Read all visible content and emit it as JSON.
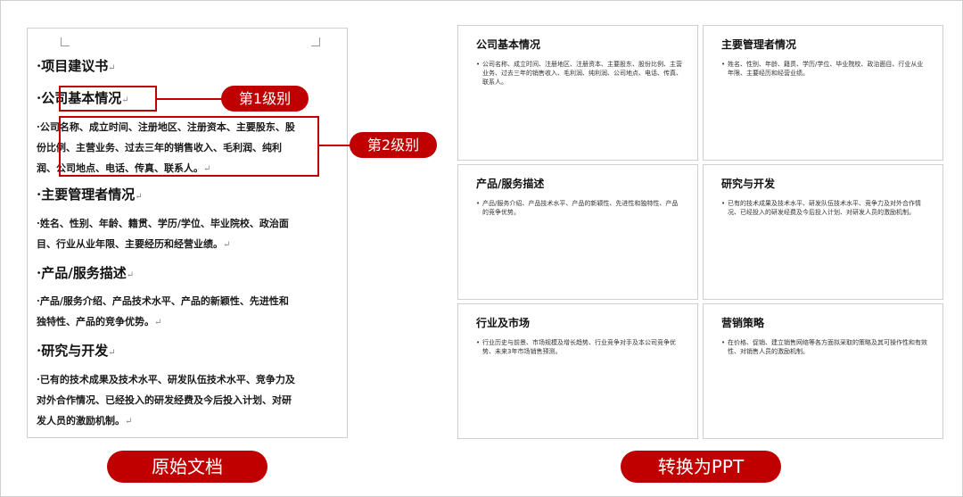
{
  "doc": {
    "title": "·项目建议书",
    "sections": [
      {
        "heading": "·公司基本情况",
        "body": "·公司名称、成立时间、注册地区、注册资本、主要股东、股份比例、主营业务、过去三年的销售收入、毛利润、纯利润、公司地点、电话、传真、联系人。"
      },
      {
        "heading": "·主要管理者情况",
        "body": "·姓名、性别、年龄、籍贯、学历/学位、毕业院校、政治面目、行业从业年限、主要经历和经营业绩。"
      },
      {
        "heading": "·产品/服务描述",
        "body": "·产品/服务介绍、产品技术水平、产品的新颖性、先进性和独特性、产品的竞争优势。"
      },
      {
        "heading": "·研究与开发",
        "body": "·已有的技术成果及技术水平、研发队伍技术水平、竞争力及对外合作情况、已经投入的研发经费及今后投入计划、对研发人员的激励机制。"
      }
    ],
    "mark": "↵"
  },
  "callouts": {
    "level1": "第1级别",
    "level2": "第2级别"
  },
  "captions": {
    "original": "原始文档",
    "converted": "转换为PPT"
  },
  "slides": [
    {
      "title": "公司基本情况",
      "bullet": "公司名称、成立时间、注册地区、注册资本、主要股东、股份比例、主营业务、过去三年的销售收入、毛利润、纯利润、公司地点、电话、传真、联系人。"
    },
    {
      "title": "主要管理者情况",
      "bullet": "姓名、性别、年龄、籍贯、学历/学位、毕业院校、政治面目、行业从业年限、主要经历和经营业绩。"
    },
    {
      "title": "产品/服务描述",
      "bullet": "产品/服务介绍、产品技术水平、产品的新颖性、先进性和独特性、产品的竞争优势。"
    },
    {
      "title": "研究与开发",
      "bullet": "已有的技术成果及技术水平、研发队伍技术水平、竞争力及对外合作情况、已经投入的研发经费及今后投入计划、对研发人员的激励机制。"
    },
    {
      "title": "行业及市场",
      "bullet": "行业历史与前景、市场规模及增长趋势、行业竞争对手及本公司竞争优势、未来3年市场销售预测。"
    },
    {
      "title": "营销策略",
      "bullet": "在价格、促销、建立销售网络等各方面拟采取的策略及其可操作性和有效性、对销售人员的激励机制。"
    }
  ],
  "colors": {
    "accent": "#c00000",
    "border": "#cfcfcf"
  }
}
